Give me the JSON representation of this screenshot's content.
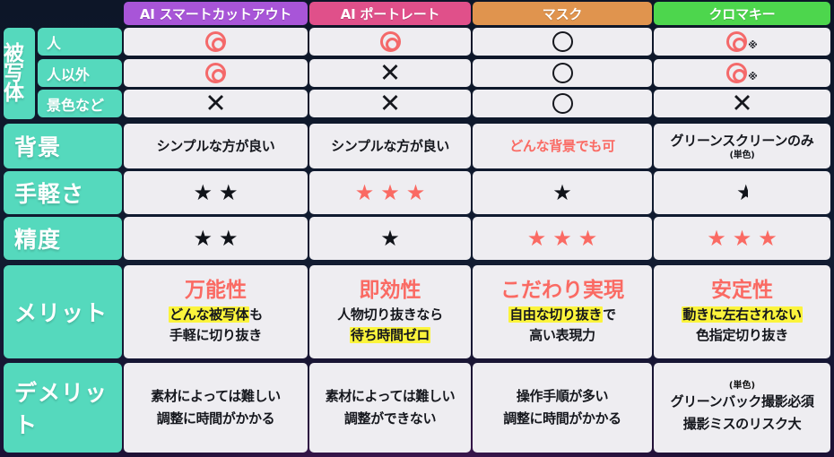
{
  "meta": {
    "title": "切り抜き手法 比較表",
    "colors": {
      "background": "#101a2e",
      "cell": "#eeedf1",
      "row_label": "#55d9bd",
      "accent_red": "#fa6a63",
      "highlight": "#fbf43c",
      "col_ai_smart": "#a855d8",
      "col_ai_portrait": "#e0508a",
      "col_mask": "#e0944e",
      "col_chromakey": "#4dd64d"
    }
  },
  "columns": [
    {
      "label": "AI スマートカットアウト",
      "color": "#a855d8"
    },
    {
      "label": "AI ポートレート",
      "color": "#e0508a"
    },
    {
      "label": "マスク",
      "color": "#e0944e"
    },
    {
      "label": "クロマキー",
      "color": "#4dd64d"
    }
  ],
  "row_labels": {
    "subject": "被写体",
    "subject_subs": [
      "人",
      "人以外",
      "景色など"
    ],
    "background": "背景",
    "ease": "手軽さ",
    "accuracy": "精度",
    "merit": "メリット",
    "demerit": "デメリット"
  },
  "rows": {
    "subject_person": {
      "icons": [
        "double-circle",
        "double-circle",
        "circle",
        "double-circle"
      ],
      "notes": [
        "",
        "",
        "",
        "※"
      ]
    },
    "subject_nonperson": {
      "icons": [
        "double-circle",
        "cross",
        "circle",
        "double-circle"
      ],
      "notes": [
        "",
        "",
        "",
        "※"
      ]
    },
    "subject_scenery": {
      "icons": [
        "cross",
        "cross",
        "circle",
        "cross"
      ],
      "notes": [
        "",
        "",
        "",
        ""
      ]
    },
    "background": [
      {
        "text": "シンプルな方が良い",
        "red": false,
        "sub": ""
      },
      {
        "text": "シンプルな方が良い",
        "red": false,
        "sub": ""
      },
      {
        "text": "どんな背景でも可",
        "red": true,
        "sub": ""
      },
      {
        "text": "グリーンスクリーンのみ",
        "red": false,
        "sub": "(単色)"
      }
    ],
    "ease": [
      {
        "stars": 2,
        "color": "black",
        "half": false
      },
      {
        "stars": 3,
        "color": "red",
        "half": false
      },
      {
        "stars": 1,
        "color": "black",
        "half": false
      },
      {
        "stars": 0,
        "color": "black",
        "half": true
      }
    ],
    "accuracy": [
      {
        "stars": 2,
        "color": "black",
        "half": false
      },
      {
        "stars": 1,
        "color": "black",
        "half": false
      },
      {
        "stars": 3,
        "color": "red",
        "half": false
      },
      {
        "stars": 3,
        "color": "red",
        "half": false
      }
    ],
    "merit": [
      {
        "title": "万能性",
        "line1": "どんな被写体",
        "line1_tail": "も",
        "line1_highlight": true,
        "line2": "手軽に切り抜き",
        "line2_highlight": false
      },
      {
        "title": "即効性",
        "line1": "人物切り抜きなら",
        "line1_tail": "",
        "line1_highlight": false,
        "line2": "待ち時間ゼロ",
        "line2_highlight": true
      },
      {
        "title": "こだわり実現",
        "line1": "自由な切り抜き",
        "line1_tail": "で",
        "line1_highlight": true,
        "line2": "高い表現力",
        "line2_highlight": false
      },
      {
        "title": "安定性",
        "line1": "動きに左右されない",
        "line1_tail": "",
        "line1_highlight": true,
        "line2": "色指定切り抜き",
        "line2_highlight": false
      }
    ],
    "demerit": [
      {
        "sup": "",
        "line1": "素材によっては難しい",
        "line2": "調整に時間がかかる"
      },
      {
        "sup": "",
        "line1": "素材によっては難しい",
        "line2": "調整ができない"
      },
      {
        "sup": "",
        "line1": "操作手順が多い",
        "line2": "調整に時間がかかる"
      },
      {
        "sup": "(単色)",
        "line1": "グリーンバック撮影必須",
        "line2": "撮影ミスのリスク大"
      }
    ]
  }
}
